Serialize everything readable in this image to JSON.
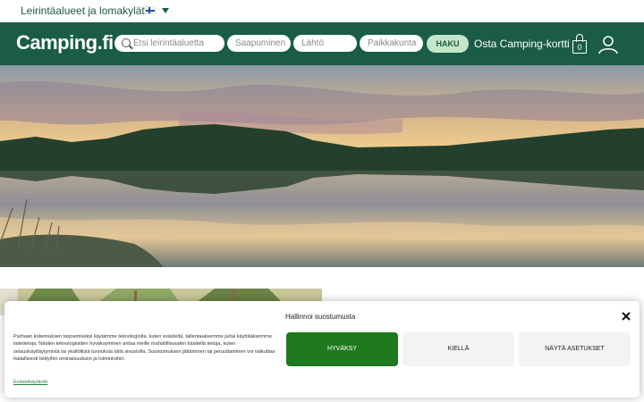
{
  "topbar": {
    "site_link": "Leirintäalueet ja lomakylät",
    "language": "fi"
  },
  "navbar": {
    "logo": "Camping.fi",
    "search_placeholder": "Etsi leirintäaluetta",
    "arrival_placeholder": "Saapuminen",
    "departure_placeholder": "Lähtö",
    "place_placeholder": "Paikkakunta",
    "search_button": "HAKU",
    "camping_card_link": "Osta Camping-kortti",
    "cart_count": "0",
    "icons": [
      "search-icon",
      "cart-icon",
      "user-icon"
    ]
  },
  "cookie_banner": {
    "title": "Hallinnoi suostumusta",
    "body": "Parhaan kokemuksen tarjoamiseksi käytämme teknologioita, kuten evästeitä, tallentaaksemme ja/tai käyttääksemme laitetietoja. Näiden teknologioiden hyväksyminen antaa meille mahdollisuuden käsitellä tietoja, kuten selauskäyttäytymistä tai yksilöllisiä tunnuksia tällä sivustolla. Suostumuksen jättäminen tai peruuttaminen voi vaikuttaa haitallisesti tiettyihin ominaisuuksiin ja toimintoihin.",
    "policy_link": "Evästekäytäntö",
    "accept_label": "HYVÄKSY",
    "deny_label": "KIELLÄ",
    "preferences_label": "NÄYTÄ ASETUKSET"
  },
  "colors": {
    "brand_green": "#1a5c46",
    "accept_green": "#1f7a1f",
    "search_button_bg": "#c4e6c8"
  }
}
